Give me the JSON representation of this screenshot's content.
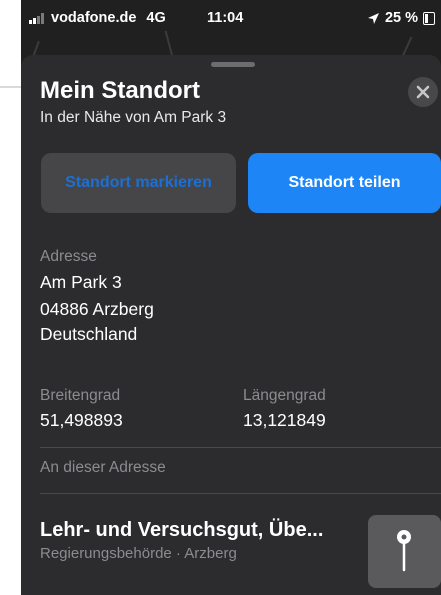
{
  "status_bar": {
    "carrier": "vodafone.de",
    "network": "4G",
    "time": "11:04",
    "battery": "25 %"
  },
  "sheet": {
    "title": "Mein Standort",
    "subtitle": "In der Nähe von Am Park 3",
    "close_icon": "close-icon"
  },
  "actions": {
    "mark_label": "Standort markieren",
    "share_label": "Standort teilen"
  },
  "address": {
    "label": "Adresse",
    "lines": [
      "Am Park 3",
      "04886 Arzberg",
      "Deutschland"
    ]
  },
  "coordinates": {
    "lat_label": "Breitengrad",
    "lat_value": "51,498893",
    "lon_label": "Längengrad",
    "lon_value": "13,121849"
  },
  "nearby": {
    "section_label": "An dieser Adresse",
    "place_name": "Lehr- und Versuchsgut, Übe...",
    "place_detail": "Regierungsbehörde · Arzberg",
    "thumb_icon": "map-pin-icon"
  },
  "colors": {
    "accent": "#1e85f7",
    "sheet_bg": "#2c2c2e"
  }
}
